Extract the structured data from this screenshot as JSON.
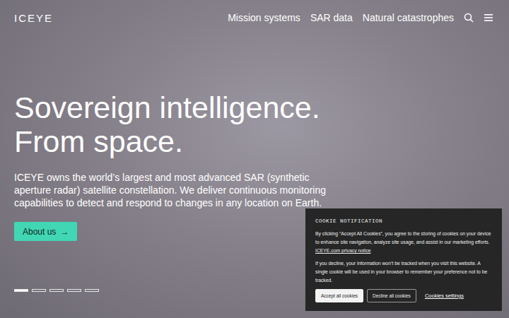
{
  "header": {
    "logo": "ICEYE",
    "nav": [
      "Mission systems",
      "SAR data",
      "Natural catastrophes"
    ]
  },
  "hero": {
    "heading": [
      "Sovereign intelligence.",
      "From space."
    ],
    "text": "ICEYE owns the world’s largest and most advanced SAR (synthetic aperture radar) satellite constellation. We deliver continuous monitoring capabilities to detect and respond to changes in any location on Earth.",
    "button": {
      "label": "About us",
      "arrow": "→"
    }
  },
  "slides": [
    {
      "selected": true
    },
    {
      "selected": false
    },
    {
      "selected": false
    },
    {
      "selected": false
    },
    {
      "selected": false
    }
  ],
  "cookie": {
    "title": "COOKIE NOTIFICATION",
    "text": "By clicking “Accept All Cookies”, you agree to the storing of cookies on your device to enhance site navigation, analyze site usage, and assist in our marketing efforts.",
    "link": "ICEYE.com privacy notice",
    "note": "If you decline, your information won’t be tracked when you visit this website. A single cookie will be used in your browser to remember your preference not to be tracked.",
    "buttons": [
      {
        "label": "Accept all cookies",
        "kind": "filled"
      },
      {
        "label": "Decline all cookies",
        "kind": "outlined"
      },
      {
        "label": "Cookies settings",
        "kind": "link"
      }
    ]
  }
}
